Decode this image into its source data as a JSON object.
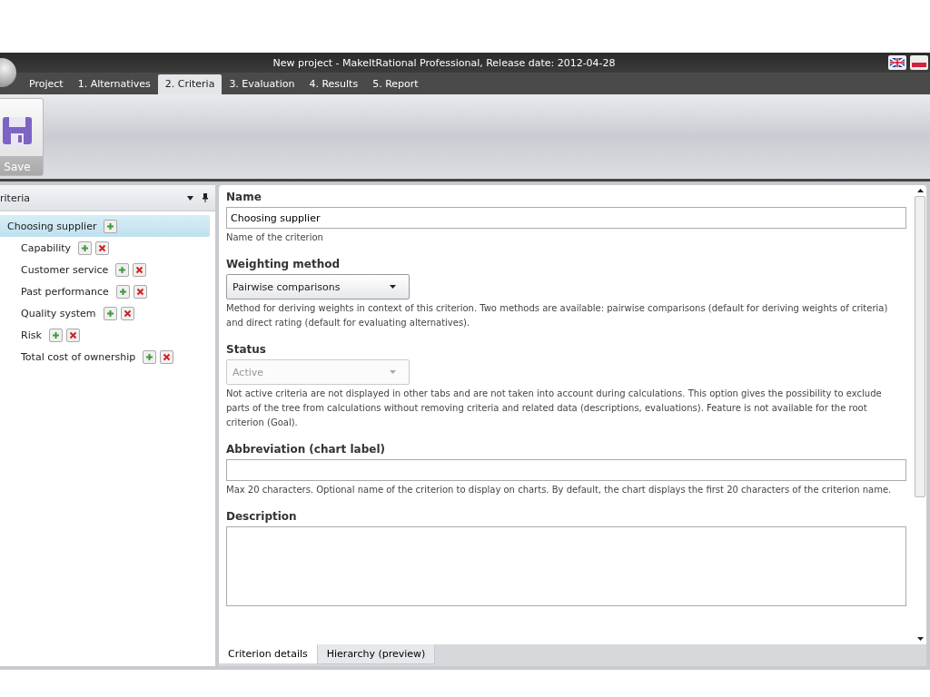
{
  "window": {
    "title": "New project - MakeItRational Professional, Release date: 2012-04-28"
  },
  "tabs": [
    {
      "label": "Project",
      "selected": false
    },
    {
      "label": "1. Alternatives",
      "selected": false
    },
    {
      "label": "2. Criteria",
      "selected": true
    },
    {
      "label": "3. Evaluation",
      "selected": false
    },
    {
      "label": "4. Results",
      "selected": false
    },
    {
      "label": "5. Report",
      "selected": false
    }
  ],
  "toolbar": {
    "save_label": "Save"
  },
  "criteria_panel": {
    "title": "riteria",
    "tree": [
      {
        "label": "Choosing supplier",
        "selected": true,
        "removable": false,
        "children": [
          {
            "label": "Capability",
            "selected": false,
            "removable": true
          },
          {
            "label": "Customer service",
            "selected": false,
            "removable": true
          },
          {
            "label": "Past performance",
            "selected": false,
            "removable": true
          },
          {
            "label": "Quality system",
            "selected": false,
            "removable": true
          },
          {
            "label": "Risk",
            "selected": false,
            "removable": true
          },
          {
            "label": "Total cost of ownership",
            "selected": false,
            "removable": true
          }
        ]
      }
    ]
  },
  "details": {
    "fields": [
      {
        "kind": "text",
        "label": "Name",
        "value": "Choosing supplier",
        "help": "Name of the criterion"
      },
      {
        "kind": "dropdown",
        "label": "Weighting method",
        "value": "Pairwise comparisons",
        "disabled": false,
        "help": "Method for deriving weights in context of this criterion. Two methods are available: pairwise comparisons (default for deriving weights of criteria) and direct rating (default for evaluating alternatives)."
      },
      {
        "kind": "dropdown",
        "label": "Status",
        "value": "Active",
        "disabled": true,
        "help": "Not active criteria are not displayed in other tabs and are not taken into account during calculations. This option gives the possibility to exclude parts of the tree from calculations without removing criteria and related data (descriptions, evaluations). Feature is not available for the root criterion (Goal)."
      },
      {
        "kind": "text",
        "label": "Abbreviation (chart label)",
        "help": "Max 20 characters. Optional name of the criterion to display on charts. By default, the chart displays the first 20 characters of the criterion name."
      },
      {
        "kind": "textarea",
        "label": "Description"
      }
    ],
    "bottom_tabs": [
      {
        "label": "Criterion details",
        "selected": true
      },
      {
        "label": "Hierarchy (preview)",
        "selected": false
      }
    ]
  }
}
